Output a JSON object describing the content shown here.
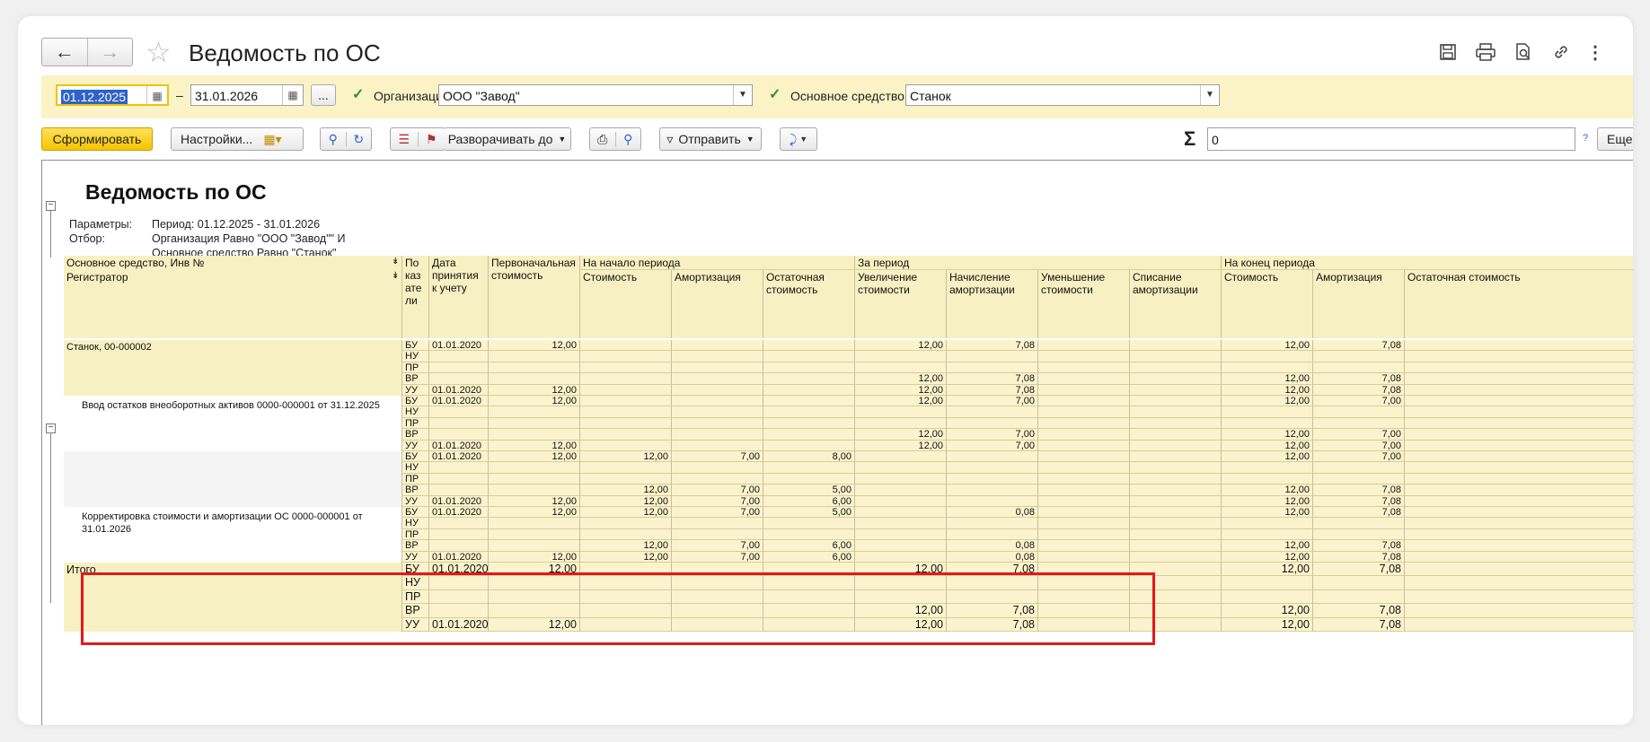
{
  "window": {
    "title": "Ведомость по ОС",
    "icons": [
      "back-arrow-icon",
      "forward-arrow-icon",
      "star-icon",
      "save-icon",
      "print-icon",
      "preview-icon",
      "link-icon",
      "more-vertical-icon"
    ]
  },
  "filters": {
    "date_from": "01.12.2025",
    "dash": "–",
    "date_to": "31.01.2026",
    "dots": "...",
    "org_label": "Организация:",
    "org_value": "ООО \"Завод\"",
    "asset_label": "Основное средство:",
    "asset_value": "Станок"
  },
  "toolbar": {
    "generate": "Сформировать",
    "settings": "Настройки...",
    "expand": "Разворачивать до",
    "send": "Отправить",
    "sigma_value": "0",
    "help": "?",
    "more": "Еще"
  },
  "report": {
    "title": "Ведомость по ОС",
    "params_label": "Параметры:",
    "params_value": "Период: 01.12.2025 - 31.01.2026",
    "filter_label": "Отбор:",
    "filter_line1": "Организация Равно \"ООО \"Завод\"\" И",
    "filter_line2": "Основное средство Равно \"Станок\"",
    "header": {
      "col_asset": "Основное средство, Инв №",
      "col_registrator": "Регистратор",
      "col_indicator": "По каз ате ли",
      "col_date": "Дата принятия к учету",
      "col_initial": "Первоначальная стоимость",
      "group_start": "На начало периода",
      "group_period": "За период",
      "group_end": "На конец периода",
      "cost": "Стоимость",
      "amort": "Амортизация",
      "residual": "Остаточная стоимость",
      "increase": "Увеличение стоимости",
      "accrual": "Начисление амортизации",
      "decrease": "Уменьшение стоимости",
      "writeoff": "Списание амортизации"
    },
    "groups": [
      {
        "name": "Станок, 00-000002",
        "rows": [
          [
            "БУ",
            "01.01.2020",
            "12,00",
            "",
            "",
            "",
            "12,00",
            "7,08",
            "",
            "",
            "12,00",
            "7,08"
          ],
          [
            "НУ",
            "",
            "",
            "",
            "",
            "",
            "",
            "",
            "",
            "",
            "",
            ""
          ],
          [
            "ПР",
            "",
            "",
            "",
            "",
            "",
            "",
            "",
            "",
            "",
            "",
            ""
          ],
          [
            "ВР",
            "",
            "",
            "",
            "",
            "",
            "12,00",
            "7,08",
            "",
            "",
            "12,00",
            "7,08"
          ],
          [
            "УУ",
            "01.01.2020",
            "12,00",
            "",
            "",
            "",
            "12,00",
            "7,08",
            "",
            "",
            "12,00",
            "7,08"
          ]
        ]
      },
      {
        "name": "Ввод остатков внеоборотных активов 0000-000001 от 31.12.2025",
        "rows": [
          [
            "БУ",
            "01.01.2020",
            "12,00",
            "",
            "",
            "",
            "12,00",
            "7,00",
            "",
            "",
            "12,00",
            "7,00"
          ],
          [
            "НУ",
            "",
            "",
            "",
            "",
            "",
            "",
            "",
            "",
            "",
            "",
            ""
          ],
          [
            "ПР",
            "",
            "",
            "",
            "",
            "",
            "",
            "",
            "",
            "",
            "",
            ""
          ],
          [
            "ВР",
            "",
            "",
            "",
            "",
            "",
            "12,00",
            "7,00",
            "",
            "",
            "12,00",
            "7,00"
          ],
          [
            "УУ",
            "01.01.2020",
            "12,00",
            "",
            "",
            "",
            "12,00",
            "7,00",
            "",
            "",
            "12,00",
            "7,00"
          ]
        ]
      },
      {
        "name": "",
        "rows": [
          [
            "БУ",
            "01.01.2020",
            "12,00",
            "12,00",
            "7,00",
            "8,00",
            "",
            "",
            "",
            "",
            "12,00",
            "7,00"
          ],
          [
            "НУ",
            "",
            "",
            "",
            "",
            "",
            "",
            "",
            "",
            "",
            "",
            ""
          ],
          [
            "ПР",
            "",
            "",
            "",
            "",
            "",
            "",
            "",
            "",
            "",
            "",
            ""
          ],
          [
            "ВР",
            "",
            "",
            "12,00",
            "7,00",
            "5,00",
            "",
            "",
            "",
            "",
            "12,00",
            "7,08"
          ],
          [
            "УУ",
            "01.01.2020",
            "12,00",
            "12,00",
            "7,00",
            "6,00",
            "",
            "",
            "",
            "",
            "12,00",
            "7,08"
          ]
        ]
      },
      {
        "name": "Корректировка стоимости и амортизации ОС 0000-000001 от 31.01.2026",
        "rows": [
          [
            "БУ",
            "01.01.2020",
            "12,00",
            "12,00",
            "7,00",
            "5,00",
            "",
            "0,08",
            "",
            "",
            "12,00",
            "7,08"
          ],
          [
            "НУ",
            "",
            "",
            "",
            "",
            "",
            "",
            "",
            "",
            "",
            "",
            ""
          ],
          [
            "ПР",
            "",
            "",
            "",
            "",
            "",
            "",
            "",
            "",
            "",
            "",
            ""
          ],
          [
            "ВР",
            "",
            "",
            "12,00",
            "7,00",
            "6,00",
            "",
            "0,08",
            "",
            "",
            "12,00",
            "7,08"
          ],
          [
            "УУ",
            "01.01.2020",
            "12,00",
            "12,00",
            "7,00",
            "6,00",
            "",
            "0,08",
            "",
            "",
            "12,00",
            "7,08"
          ]
        ]
      }
    ],
    "total": {
      "name": "Итого",
      "rows": [
        [
          "БУ",
          "01.01.2020",
          "12,00",
          "",
          "",
          "",
          "12,00",
          "7,08",
          "",
          "",
          "12,00",
          "7,08"
        ],
        [
          "НУ",
          "",
          "",
          "",
          "",
          "",
          "",
          "",
          "",
          "",
          "",
          ""
        ],
        [
          "ПР",
          "",
          "",
          "",
          "",
          "",
          "",
          "",
          "",
          "",
          "",
          ""
        ],
        [
          "ВР",
          "",
          "",
          "",
          "",
          "",
          "12,00",
          "7,08",
          "",
          "",
          "12,00",
          "7,08"
        ],
        [
          "УУ",
          "01.01.2020",
          "12,00",
          "",
          "",
          "",
          "12,00",
          "7,08",
          "",
          "",
          "12,00",
          "7,08"
        ]
      ]
    }
  },
  "colors": {
    "highlight_border": "#e11a1a",
    "header_bg": "#f7f0c2",
    "filter_bg": "#fbf3c6",
    "accent_button": "#f5c400"
  }
}
